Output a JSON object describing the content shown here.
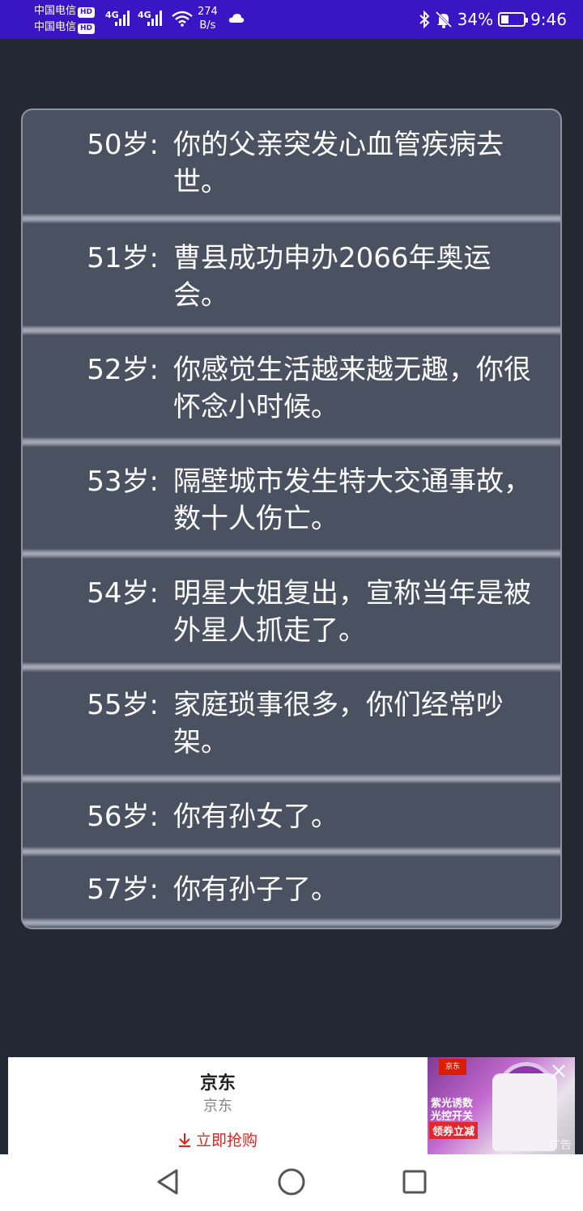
{
  "status_bar": {
    "carrier1": "中国电信",
    "carrier2": "中国电信",
    "hd": "HD",
    "net1": "4G",
    "net2": "4G",
    "speed_value": "274",
    "speed_unit": "B/s",
    "battery": "34%",
    "battery_level": 0.34,
    "time": "9:46"
  },
  "events": [
    {
      "age": "50岁:",
      "text": "你的父亲突发心血管疾病去世。"
    },
    {
      "age": "51岁:",
      "text": "曹县成功申办2066年奥运会。"
    },
    {
      "age": "52岁:",
      "text": "你感觉生活越来越无趣，你很怀念小时候。"
    },
    {
      "age": "53岁:",
      "text": "隔壁城市发生特大交通事故，数十人伤亡。"
    },
    {
      "age": "54岁:",
      "text": "明星大姐复出，宣称当年是被外星人抓走了。"
    },
    {
      "age": "55岁:",
      "text": "家庭琐事很多，你们经常吵架。"
    },
    {
      "age": "56岁:",
      "text": "你有孙女了。"
    },
    {
      "age": "57岁:",
      "text": "你有孙子了。"
    }
  ],
  "ad": {
    "title": "京东",
    "subtitle": "京东",
    "cta": "立即抢购",
    "image_badge": "京东",
    "image_line1": "紫光诱数",
    "image_line2": "光控开关",
    "image_button": "领券立减",
    "label": "广告"
  },
  "colors": {
    "status_bar": "#3a15c4",
    "background": "#232833",
    "card": "#4a5262",
    "ad_cta": "#e02020"
  },
  "icons": {
    "bluetooth": "bluetooth-icon",
    "mute": "bell-off-icon",
    "wifi": "wifi-icon",
    "cloud": "cloud-icon",
    "back": "triangle-back-icon",
    "home": "circle-home-icon",
    "recents": "square-recents-icon"
  }
}
